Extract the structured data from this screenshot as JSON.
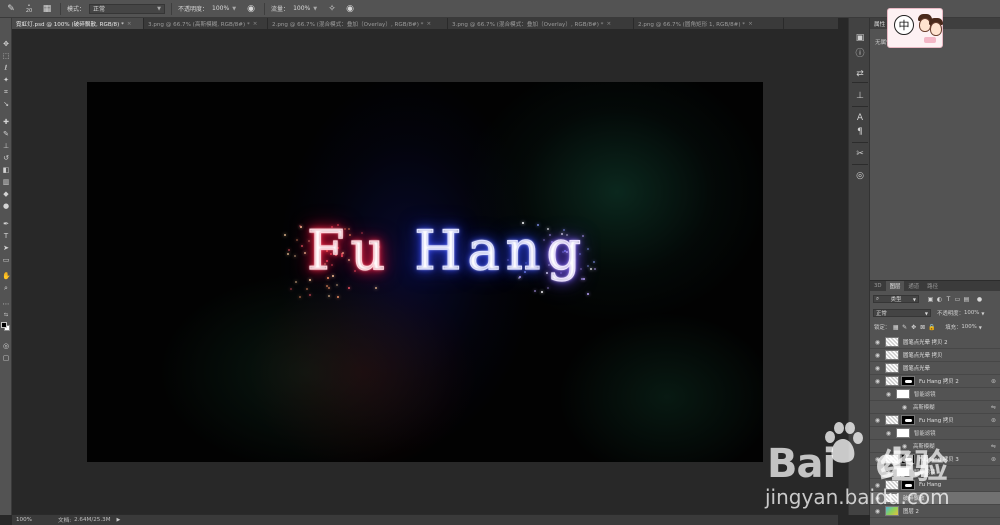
{
  "options_bar": {
    "brush_size": "20",
    "mode_label": "模式：",
    "mode_value": "正常",
    "opacity_label": "不透明度：",
    "opacity_value": "100%",
    "flow_label": "流量：",
    "flow_value": "100%"
  },
  "tabs": [
    {
      "label": "霓虹灯.psd @ 100% (破碎飘散, RGB/8) *",
      "active": true
    },
    {
      "label": "3.png @ 66.7% (高斯模糊, RGB/8#) *",
      "active": false
    },
    {
      "label": "2.png @ 66.7% (混合模式：叠加（Overlay）, RGB/8#) *",
      "active": false
    },
    {
      "label": "3.png @ 66.7% (混合模式：叠加（Overlay）, RGB/8#) *",
      "active": false
    },
    {
      "label": "2.png @ 66.7% (圆角矩形 1, RGB/8#) *",
      "active": false
    }
  ],
  "canvas": {
    "text_red": "Fu",
    "text_blue": "Han",
    "text_violet": "g"
  },
  "status": {
    "zoom": "100%",
    "doc_label": "文档:",
    "doc_size": "2.64M/25.3M"
  },
  "properties": {
    "title": "属性",
    "note": "无属性"
  },
  "ime": {
    "key": "中"
  },
  "layers_panel": {
    "tabs": [
      "3D",
      "图层",
      "通道",
      "路径"
    ],
    "filter_kind": "类型",
    "blend_mode": "正常",
    "opacity_label": "不透明度：",
    "opacity_value": "100%",
    "lock_label": "锁定：",
    "fill_label": "填充：",
    "fill_value": "100%",
    "layers": [
      {
        "name": "圆笔点光晕 拷贝 2",
        "type": "pixel",
        "visible": true
      },
      {
        "name": "圆笔点光晕 拷贝",
        "type": "pixel",
        "visible": true
      },
      {
        "name": "圆笔点光晕",
        "type": "pixel",
        "visible": true
      },
      {
        "name": "Fu Hang 拷贝 2",
        "type": "smart",
        "visible": true
      },
      {
        "name": "智能滤镜",
        "type": "sub-filter",
        "visible": true
      },
      {
        "name": "高斯模糊",
        "type": "sub-item",
        "visible": true
      },
      {
        "name": "Fu Hang 拷贝",
        "type": "smart",
        "visible": true
      },
      {
        "name": "智能滤镜",
        "type": "sub-filter",
        "visible": true
      },
      {
        "name": "高斯模糊",
        "type": "sub-item",
        "visible": true
      },
      {
        "name": "Fu Hang 拷贝 3",
        "type": "smart",
        "visible": true
      },
      {
        "name": "智能滤镜",
        "type": "sub-filter",
        "visible": true
      },
      {
        "name": "Fu Hang",
        "type": "smart",
        "visible": true
      },
      {
        "name": "破碎飘散",
        "type": "pixel",
        "visible": true,
        "selected": true
      },
      {
        "name": "图层 2",
        "type": "image",
        "visible": true
      }
    ]
  },
  "watermark": {
    "brand": "Bai",
    "brand2": "du",
    "cn": "经验",
    "url": "jingyan.baidu.com"
  },
  "colors": {
    "neon_red": "#ff1a40",
    "neon_blue": "#3048ff",
    "neon_violet": "#7050ff",
    "panel_bg": "#535353",
    "workspace_bg": "#282828"
  }
}
